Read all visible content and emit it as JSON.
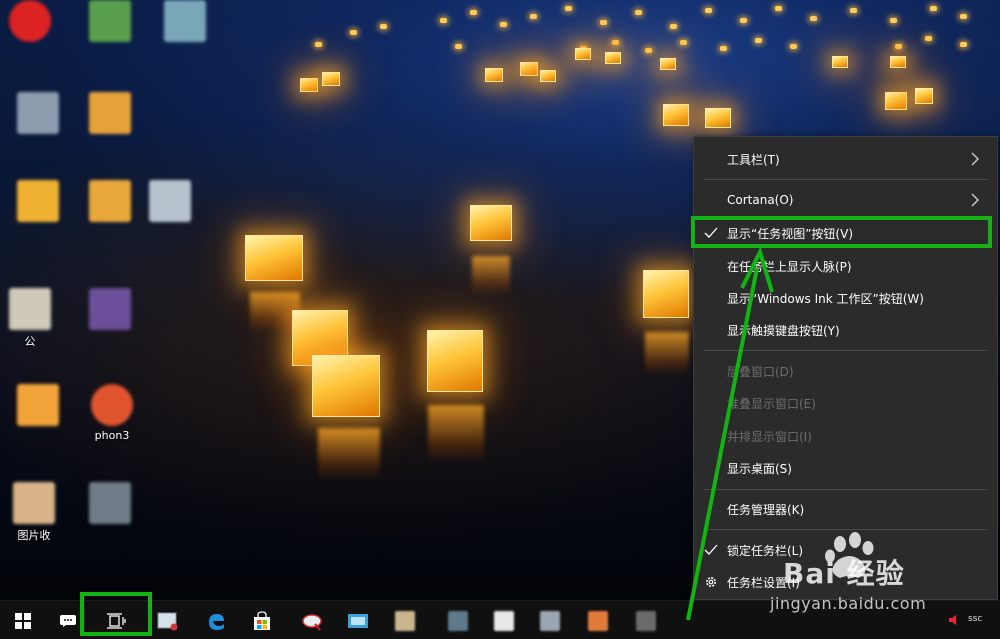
{
  "desktop": {
    "icons": [
      {
        "label": "",
        "color": "#d22"
      },
      {
        "label": "",
        "color": "#5a9f4c"
      },
      {
        "label": "",
        "color": "#7aa7b8"
      },
      {
        "label": "",
        "color": "#8e9cb0"
      },
      {
        "label": "",
        "color": "#e6a23a"
      },
      {
        "label": "",
        "color": "#f0b232"
      },
      {
        "label": "",
        "color": "#e9a83c"
      },
      {
        "label": "",
        "color": "#b8c2cc"
      },
      {
        "label": "公",
        "color": "#cfcab8"
      },
      {
        "label": "",
        "color": "#6b4f9a"
      },
      {
        "label": "",
        "color": "#f2a33a"
      },
      {
        "label": "phon3",
        "color": "#e0542e"
      },
      {
        "label": "图片收",
        "color": "#d9b48a"
      },
      {
        "label": "",
        "color": "#6f7b86"
      }
    ]
  },
  "context_menu": {
    "items": [
      {
        "label": "工具栏(T)",
        "submenu": true,
        "disabled": false
      },
      {
        "label": "Cortana(O)",
        "submenu": true,
        "disabled": false
      },
      {
        "label": "显示“任务视图”按钮(V)",
        "checked": true,
        "disabled": false
      },
      {
        "label": "在任务栏上显示人脉(P)",
        "disabled": false
      },
      {
        "label": "显示“Windows Ink 工作区”按钮(W)",
        "disabled": false
      },
      {
        "label": "显示触摸键盘按钮(Y)",
        "disabled": false
      },
      {
        "label": "层叠窗口(D)",
        "disabled": true
      },
      {
        "label": "堆叠显示窗口(E)",
        "disabled": true
      },
      {
        "label": "并排显示窗口(I)",
        "disabled": true
      },
      {
        "label": "显示桌面(S)",
        "disabled": false
      },
      {
        "label": "任务管理器(K)",
        "disabled": false
      },
      {
        "label": "锁定任务栏(L)",
        "checked": true,
        "disabled": false
      },
      {
        "label": "任务栏设置(I)",
        "icon": "gear-icon",
        "disabled": false
      }
    ]
  },
  "taskbar": {
    "icons": [
      "windows-start-icon",
      "cortana-icon",
      "task-view-icon",
      "app-icon",
      "edge-icon",
      "store-icon",
      "app-icon",
      "app-icon"
    ],
    "tray_label": "ssc"
  },
  "watermark": {
    "brand": "Bai 经验",
    "url": "jingyan.baidu.com"
  },
  "colors": {
    "highlight": "#13b313",
    "menu_bg": "#2b2b2b",
    "taskbar_bg": "#101010",
    "disabled_text": "#6d6d6d"
  }
}
